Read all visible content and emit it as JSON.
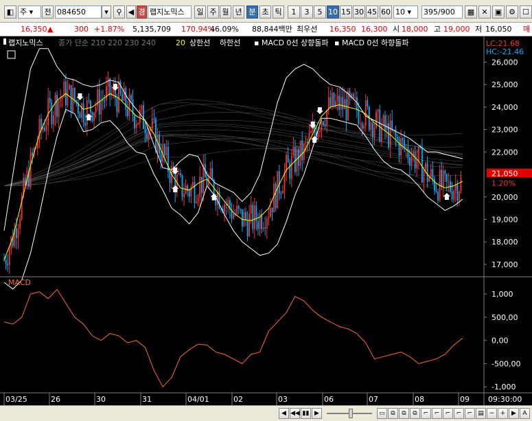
{
  "toolbar": {
    "market": "주",
    "prev_label": "전",
    "code": "084650",
    "search_icon": "search-icon",
    "sound_icon": "speaker-icon",
    "warning_badge": "경",
    "stock_name": "랩지노믹스",
    "periods": [
      "일",
      "주",
      "월",
      "년",
      "분",
      "초",
      "틱"
    ],
    "active_period": "분",
    "intervals": [
      "1",
      "3",
      "5",
      "10",
      "15",
      "30",
      "45",
      "60"
    ],
    "active_interval": "10",
    "count_select": "10",
    "range_value": "395",
    "range_total": "/900"
  },
  "quote": {
    "price": "16,350",
    "change_symbol": "▲",
    "change": "300",
    "change_pct": "+1.87%",
    "volume": "5,135,709",
    "volume_ratio": "170.94%",
    "turnover_pct": "46.09%",
    "amount": "88,844백만",
    "bid_label": "최우선",
    "ask": "16,350",
    "bid": "16,300",
    "open_label": "시",
    "open": "18,000",
    "high_label": "고",
    "high": "19,000",
    "low_label": "저",
    "low": "16,050",
    "right_tag": "매"
  },
  "chart": {
    "legend": {
      "stock_name": "랩지노믹스",
      "mas": "종가 단순 210  220  230  240",
      "ma20": "20",
      "upper": "상한선",
      "lower": "하한선",
      "macd_up": "MACD 0선 상향돌파",
      "macd_down": "MACD 0선 하향돌파"
    },
    "lc": "LC:21.68",
    "hc": "HC:-21.46",
    "current_price": "21,050",
    "current_pct": "1.20%",
    "macd_title": "MACD",
    "price_ticks": [
      "26,000",
      "25,000",
      "24,000",
      "23,000",
      "22,000",
      "20,000",
      "19,000",
      "18,000",
      "17,000"
    ],
    "macd_ticks": [
      "1,000",
      "500,00",
      "0,00",
      "-500,00",
      "-1,000"
    ],
    "date_labels": [
      "03/25",
      "26",
      "30",
      "31",
      "04/01",
      "02",
      "03",
      "06",
      "07",
      "08",
      "09"
    ],
    "time_label": "09:30:00"
  },
  "colors": {
    "up_candle": "#ff3030",
    "down_candle": "#00b0ff",
    "ma20": "#ffff00",
    "band": "#ffffff",
    "macd": "#ff6a2a",
    "ma_bundle": "#5a5a5a"
  },
  "chart_data": {
    "type": "line",
    "title": "",
    "y_range_price": [
      16600,
      26900
    ],
    "y_range_macd": [
      -1100,
      1150
    ],
    "dates": [
      "03/25",
      "26",
      "30",
      "31",
      "04/01",
      "02",
      "03",
      "06",
      "07",
      "08",
      "09"
    ],
    "series": [
      {
        "name": "20",
        "points": [
          [
            0,
            17200
          ],
          [
            5,
            18200
          ],
          [
            10,
            19800
          ],
          [
            15,
            21400
          ],
          [
            20,
            22800
          ],
          [
            25,
            23700
          ],
          [
            30,
            24300
          ],
          [
            35,
            24600
          ],
          [
            40,
            24300
          ],
          [
            45,
            23900
          ],
          [
            50,
            24000
          ],
          [
            55,
            24300
          ],
          [
            60,
            24600
          ],
          [
            65,
            24400
          ],
          [
            70,
            24000
          ],
          [
            75,
            23600
          ],
          [
            80,
            23400
          ],
          [
            85,
            22800
          ],
          [
            90,
            21900
          ],
          [
            95,
            21000
          ],
          [
            100,
            20400
          ],
          [
            105,
            20300
          ],
          [
            110,
            20600
          ],
          [
            115,
            20800
          ],
          [
            120,
            20300
          ],
          [
            125,
            19800
          ],
          [
            130,
            19300
          ],
          [
            135,
            19000
          ],
          [
            140,
            18950
          ],
          [
            145,
            19100
          ],
          [
            150,
            19500
          ],
          [
            155,
            20400
          ],
          [
            160,
            21200
          ],
          [
            165,
            21600
          ],
          [
            170,
            22000
          ],
          [
            175,
            22800
          ],
          [
            180,
            23600
          ],
          [
            185,
            24000
          ],
          [
            190,
            24100
          ],
          [
            195,
            24000
          ],
          [
            200,
            23900
          ],
          [
            205,
            23700
          ],
          [
            210,
            23300
          ],
          [
            215,
            23000
          ],
          [
            220,
            22700
          ],
          [
            225,
            22300
          ],
          [
            230,
            22000
          ],
          [
            235,
            21600
          ],
          [
            240,
            21000
          ],
          [
            245,
            20600
          ],
          [
            250,
            20400
          ],
          [
            255,
            20500
          ],
          [
            260,
            20700
          ]
        ]
      },
      {
        "name": "상한선",
        "points": [
          [
            0,
            18500
          ],
          [
            5,
            21000
          ],
          [
            10,
            23500
          ],
          [
            15,
            25700
          ],
          [
            20,
            26600
          ],
          [
            25,
            26600
          ],
          [
            30,
            25800
          ],
          [
            35,
            25300
          ],
          [
            40,
            25200
          ],
          [
            45,
            25000
          ],
          [
            50,
            24900
          ],
          [
            55,
            25000
          ],
          [
            60,
            25200
          ],
          [
            65,
            25100
          ],
          [
            70,
            24400
          ],
          [
            75,
            23900
          ],
          [
            80,
            23400
          ],
          [
            85,
            22300
          ],
          [
            90,
            21300
          ],
          [
            95,
            21200
          ],
          [
            100,
            21600
          ],
          [
            105,
            21900
          ],
          [
            110,
            21800
          ],
          [
            115,
            21000
          ],
          [
            120,
            20600
          ],
          [
            125,
            20400
          ],
          [
            130,
            20200
          ],
          [
            135,
            19800
          ],
          [
            140,
            20200
          ],
          [
            145,
            21000
          ],
          [
            150,
            22600
          ],
          [
            155,
            24200
          ],
          [
            160,
            25300
          ],
          [
            165,
            25700
          ],
          [
            170,
            25900
          ],
          [
            175,
            25700
          ],
          [
            180,
            25300
          ],
          [
            185,
            25000
          ],
          [
            190,
            24900
          ],
          [
            195,
            24600
          ],
          [
            200,
            24200
          ],
          [
            205,
            23600
          ],
          [
            210,
            23400
          ],
          [
            215,
            23200
          ],
          [
            220,
            23000
          ],
          [
            225,
            22800
          ],
          [
            230,
            22600
          ],
          [
            235,
            22300
          ],
          [
            240,
            22000
          ],
          [
            245,
            22000
          ],
          [
            250,
            21900
          ],
          [
            255,
            21800
          ],
          [
            260,
            21700
          ]
        ]
      },
      {
        "name": "하한선",
        "points": [
          [
            0,
            16200
          ],
          [
            5,
            15900
          ],
          [
            10,
            16300
          ],
          [
            15,
            17500
          ],
          [
            20,
            19200
          ],
          [
            25,
            21100
          ],
          [
            30,
            22700
          ],
          [
            35,
            23900
          ],
          [
            40,
            23700
          ],
          [
            45,
            22900
          ],
          [
            50,
            23000
          ],
          [
            55,
            23300
          ],
          [
            60,
            23400
          ],
          [
            65,
            23000
          ],
          [
            70,
            22400
          ],
          [
            75,
            22000
          ],
          [
            80,
            21900
          ],
          [
            85,
            21000
          ],
          [
            90,
            20300
          ],
          [
            95,
            19500
          ],
          [
            100,
            19200
          ],
          [
            105,
            18800
          ],
          [
            110,
            19300
          ],
          [
            115,
            20500
          ],
          [
            120,
            20000
          ],
          [
            125,
            19200
          ],
          [
            130,
            18500
          ],
          [
            135,
            18000
          ],
          [
            140,
            17700
          ],
          [
            145,
            17400
          ],
          [
            150,
            17500
          ],
          [
            155,
            17900
          ],
          [
            160,
            18900
          ],
          [
            165,
            20100
          ],
          [
            170,
            21000
          ],
          [
            175,
            22200
          ],
          [
            180,
            23500
          ],
          [
            185,
            23500
          ],
          [
            190,
            23400
          ],
          [
            195,
            23300
          ],
          [
            200,
            23200
          ],
          [
            205,
            22700
          ],
          [
            210,
            22100
          ],
          [
            215,
            21600
          ],
          [
            220,
            21300
          ],
          [
            225,
            21200
          ],
          [
            230,
            20900
          ],
          [
            235,
            20500
          ],
          [
            240,
            20000
          ],
          [
            245,
            19700
          ],
          [
            250,
            19400
          ],
          [
            255,
            19600
          ],
          [
            260,
            19900
          ]
        ]
      },
      {
        "name": "MACD",
        "points": [
          [
            0,
            400
          ],
          [
            5,
            350
          ],
          [
            10,
            500
          ],
          [
            15,
            1000
          ],
          [
            20,
            1050
          ],
          [
            25,
            900
          ],
          [
            30,
            1100
          ],
          [
            35,
            800
          ],
          [
            40,
            500
          ],
          [
            45,
            350
          ],
          [
            50,
            100
          ],
          [
            55,
            0
          ],
          [
            60,
            150
          ],
          [
            65,
            100
          ],
          [
            70,
            -50
          ],
          [
            75,
            0
          ],
          [
            80,
            -150
          ],
          [
            85,
            -650
          ],
          [
            90,
            -1000
          ],
          [
            95,
            -800
          ],
          [
            100,
            -350
          ],
          [
            105,
            -200
          ],
          [
            110,
            -80
          ],
          [
            115,
            -100
          ],
          [
            120,
            -250
          ],
          [
            125,
            -300
          ],
          [
            130,
            -400
          ],
          [
            135,
            -500
          ],
          [
            140,
            -300
          ],
          [
            145,
            -250
          ],
          [
            150,
            200
          ],
          [
            155,
            400
          ],
          [
            160,
            600
          ],
          [
            165,
            950
          ],
          [
            170,
            850
          ],
          [
            175,
            650
          ],
          [
            180,
            500
          ],
          [
            185,
            400
          ],
          [
            190,
            300
          ],
          [
            195,
            250
          ],
          [
            200,
            150
          ],
          [
            205,
            -50
          ],
          [
            210,
            -400
          ],
          [
            215,
            -350
          ],
          [
            220,
            -300
          ],
          [
            225,
            -250
          ],
          [
            230,
            -350
          ],
          [
            235,
            -500
          ],
          [
            240,
            -450
          ],
          [
            245,
            -400
          ],
          [
            250,
            -300
          ],
          [
            255,
            -100
          ],
          [
            260,
            50
          ]
        ]
      }
    ],
    "signals": [
      {
        "x": 43,
        "dir": "down"
      },
      {
        "x": 48,
        "dir": "up"
      },
      {
        "x": 63,
        "dir": "down"
      },
      {
        "x": 97,
        "dir": "down"
      },
      {
        "x": 97,
        "dir": "up"
      },
      {
        "x": 119,
        "dir": "up"
      },
      {
        "x": 175,
        "dir": "down"
      },
      {
        "x": 176,
        "dir": "up"
      },
      {
        "x": 179,
        "dir": "down"
      },
      {
        "x": 251,
        "dir": "up"
      }
    ],
    "legend": "top-left",
    "grid": false
  }
}
